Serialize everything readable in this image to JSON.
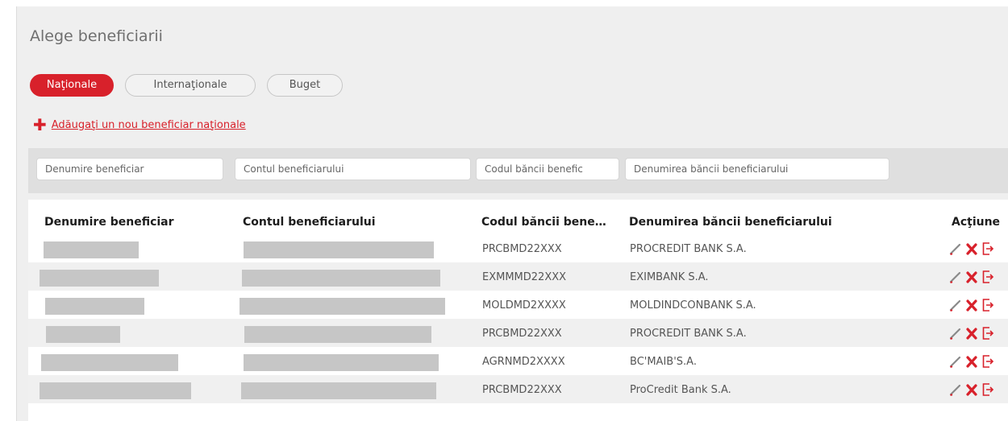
{
  "title": "Alege beneficiarii",
  "tabs": [
    {
      "label": "Naţionale",
      "active": true
    },
    {
      "label": "Internaţionale",
      "active": false
    },
    {
      "label": "Buget",
      "active": false
    }
  ],
  "add_link": "Adăugaţi un nou beneficiar naţionale",
  "filters": {
    "name_placeholder": "Denumire beneficiar",
    "account_placeholder": "Contul beneficiarului",
    "bank_code_placeholder": "Codul băncii benefic",
    "bank_name_placeholder": "Denumirea băncii beneficiarului"
  },
  "table": {
    "headers": {
      "name": "Denumire beneficiar",
      "account": "Contul beneficiarului",
      "bank_code": "Codul băncii bene…",
      "bank_name": "Denumirea băncii beneficiarului",
      "actions": "Acţiune"
    },
    "rows": [
      {
        "bank_code": "PRCBMD22XXX",
        "bank_name": "PROCREDIT BANK S.A."
      },
      {
        "bank_code": "EXMMMD22XXX",
        "bank_name": "EXIMBANK S.A."
      },
      {
        "bank_code": "MOLDMD2XXXX",
        "bank_name": "MOLDINDCONBANK S.A."
      },
      {
        "bank_code": "PRCBMD22XXX",
        "bank_name": "PROCREDIT BANK S.A."
      },
      {
        "bank_code": "AGRNMD2XXXX",
        "bank_name": "BC'MAIB'S.A."
      },
      {
        "bank_code": "PRCBMD22XXX",
        "bank_name": "ProCredit Bank S.A."
      }
    ]
  },
  "icons": {
    "add": "plus-icon",
    "edit": "pencil-icon",
    "delete": "x-icon",
    "transfer": "transfer-icon"
  },
  "colors": {
    "accent": "#d8212b",
    "panel_bg": "#efefef",
    "filter_bar_bg": "#dfdfdf",
    "redacted": "#c6c6c6"
  }
}
